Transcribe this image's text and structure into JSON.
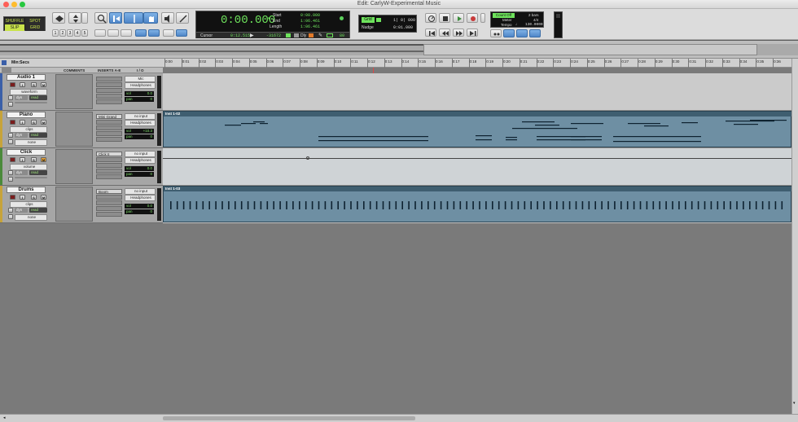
{
  "window": {
    "title": "Edit: CarlyW-Experimental Music"
  },
  "toolbar": {
    "modes": {
      "shuffle": "SHUFFLE",
      "spot": "SPOT",
      "slip": "SLIP",
      "grid": "GRID"
    },
    "zoom_presets": [
      "1",
      "2",
      "3",
      "4",
      "5"
    ],
    "main_counter": "0:00.000",
    "start_label": "Start",
    "start_value": "0:00.000",
    "end_label": "End",
    "end_value": "1:06.461",
    "length_label": "Length",
    "length_value": "1:06.461",
    "cursor_label": "Cursor",
    "cursor_value": "0:12.515",
    "cursor_sample": "-31672",
    "dly_label": "Dly",
    "nudge_extra": "80",
    "grid_label": "Grid",
    "grid_value": "1| 0| 000",
    "nudge_label": "Nudge",
    "nudge_value": "0:01.000",
    "count_off_label": "Count Off",
    "count_off_value": "2 bars",
    "meter_label": "Meter",
    "meter_value": "4/4",
    "tempo_label": "Tempo",
    "tempo_value": "130.0000"
  },
  "ruler": {
    "label": "Min:Secs",
    "ticks": [
      "0:00",
      "0:01",
      "0:02",
      "0:03",
      "0:04",
      "0:05",
      "0:06",
      "0:07",
      "0:08",
      "0:09",
      "0:10",
      "0:11",
      "0:12",
      "0:13",
      "0:14",
      "0:15",
      "0:16",
      "0:17",
      "0:18",
      "0:19",
      "0:20",
      "0:21",
      "0:22",
      "0:23",
      "0:24",
      "0:25",
      "0:26",
      "0:27",
      "0:28",
      "0:29",
      "0:30",
      "0:31",
      "0:32",
      "0:33",
      "0:34",
      "0:35",
      "0:36"
    ]
  },
  "columns": {
    "comments": "COMMENTS",
    "inserts": "INSERTS A-E",
    "io": "I / O"
  },
  "tracks": [
    {
      "name": "Audio 1",
      "view": "waveform",
      "dyn": "dyn",
      "mode": "read",
      "insert": "",
      "io_in": "Mic",
      "io_out": "Headphones",
      "vol_label": "vol",
      "vol": "0.0",
      "pan_label": "pan",
      "pan": "0",
      "color": "#3a5fa8",
      "extra": ""
    },
    {
      "name": "Piano",
      "view": "clips",
      "dyn": "dyn",
      "mode": "read",
      "insert": "Mini Grand",
      "io_in": "no input",
      "io_out": "Headphones",
      "vol_label": "vol",
      "vol": "+10.3",
      "pan_label": "pan",
      "pan": "0",
      "color": "#c7a33a",
      "extra": "none"
    },
    {
      "name": "Click",
      "view": "volume",
      "dyn": "dyn",
      "mode": "read",
      "insert": "Click II",
      "io_in": "no input",
      "io_out": "Headphones",
      "vol_label": "vol",
      "vol": "0.0",
      "pan_label": "pan",
      "pan": "0",
      "color": "#4a8a3a",
      "extra": ""
    },
    {
      "name": "Drums",
      "view": "clips",
      "dyn": "dyn",
      "mode": "read",
      "insert": "Boom",
      "io_in": "no input",
      "io_out": "Headphones",
      "vol_label": "vol",
      "vol": "0.0",
      "pan_label": "pan",
      "pan": "0",
      "color": "#c7a33a",
      "extra": "none"
    }
  ],
  "regions": {
    "piano": "Inst 1-02",
    "drums": "Inst 1-03"
  }
}
